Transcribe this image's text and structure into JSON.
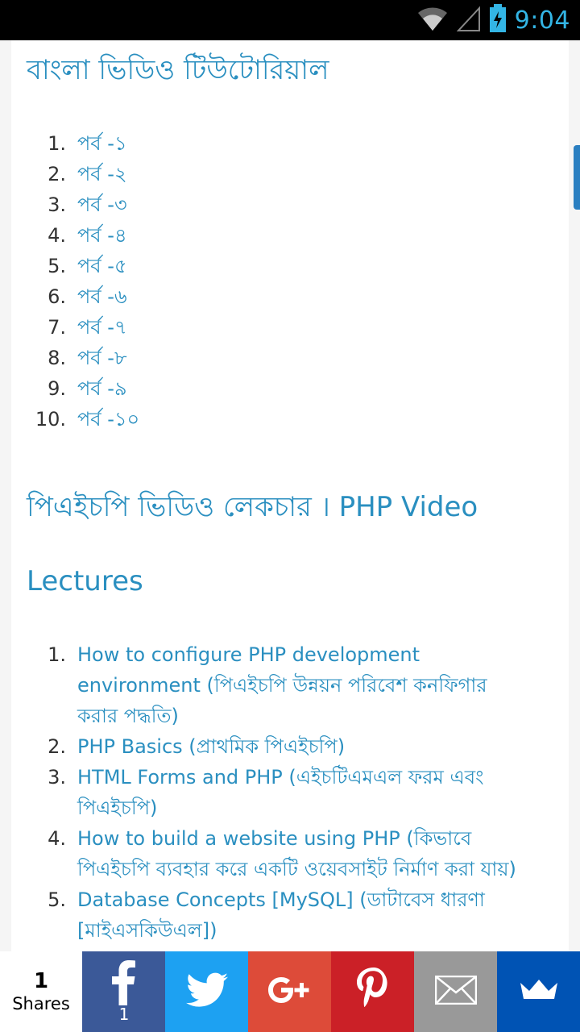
{
  "status_bar": {
    "time": "9:04"
  },
  "article": {
    "heading_tutorial": "বাংলা ভিডিও টিউটোরিয়াল",
    "parts": [
      {
        "num": "1.",
        "label": "পর্ব -১"
      },
      {
        "num": "2.",
        "label": "পর্ব -২"
      },
      {
        "num": "3.",
        "label": "পর্ব -৩"
      },
      {
        "num": "4.",
        "label": "পর্ব -৪"
      },
      {
        "num": "5.",
        "label": "পর্ব -৫"
      },
      {
        "num": "6.",
        "label": "পর্ব -৬"
      },
      {
        "num": "7.",
        "label": "পর্ব -৭"
      },
      {
        "num": "8.",
        "label": "পর্ব -৮"
      },
      {
        "num": "9.",
        "label": "পর্ব -৯"
      },
      {
        "num": "10.",
        "label": "পর্ব -১০"
      }
    ],
    "heading_lectures_line1": "পিএইচপি ভিডিও লেকচার । PHP Video",
    "heading_lectures_line2": "Lectures",
    "lectures": [
      {
        "num": "1.",
        "label": "How to configure PHP development environment (পিএইচপি উন্নয়ন পরিবেশ কনফিগার করার পদ্ধতি)"
      },
      {
        "num": "2.",
        "label": "PHP Basics (প্রাথমিক পিএইচপি)"
      },
      {
        "num": "3.",
        "label": "HTML Forms and PHP (এইচটিএমএল ফরম এবং পিএইচপি)"
      },
      {
        "num": "4.",
        "label": "How to build a website using PHP (কিভাবে পিএইচপি ব্যবহার করে একটি ওয়েবসাইট নির্মাণ করা যায়)"
      },
      {
        "num": "5.",
        "label": "Database Concepts [MySQL] (ডাটাবেস ধারণা [মাইএসকিউএল])"
      }
    ]
  },
  "share_bar": {
    "count": "1",
    "count_label": "Shares",
    "facebook_count": "1",
    "colors": {
      "facebook": "#3b5998",
      "twitter": "#1da1f2",
      "googleplus": "#dd4b39",
      "pinterest": "#cb2027",
      "email": "#999999",
      "sumo": "#0053b4"
    },
    "icons": [
      "facebook-icon",
      "twitter-icon",
      "google-plus-icon",
      "pinterest-icon",
      "email-icon",
      "crown-icon"
    ]
  }
}
